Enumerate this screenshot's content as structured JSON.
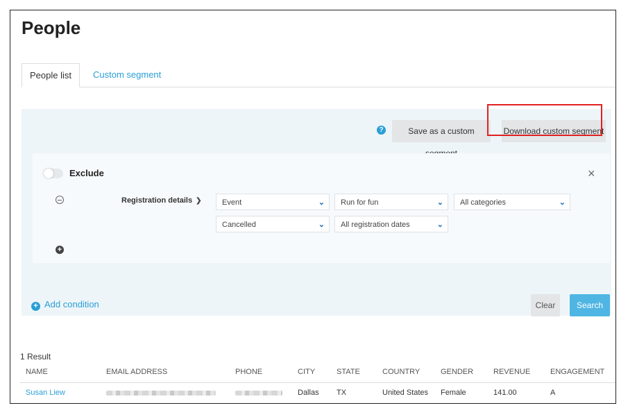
{
  "page": {
    "title": "People"
  },
  "tabs": [
    {
      "label": "People list",
      "active": true
    },
    {
      "label": "Custom segment",
      "active": false
    }
  ],
  "toolbar": {
    "help_icon": "question-circle-icon",
    "save_label": "Save as a custom segment",
    "download_label": "Download custom segment"
  },
  "condition": {
    "exclude_label": "Exclude",
    "exclude_on": false,
    "field_label": "Registration details",
    "selects_row1": [
      "Event",
      "Run for fun",
      "All categories"
    ],
    "selects_row2": [
      "Cancelled",
      "All registration dates"
    ]
  },
  "actions": {
    "add_condition_label": "Add condition",
    "clear_label": "Clear",
    "search_label": "Search"
  },
  "results": {
    "count_label": "1 Result",
    "columns": [
      "NAME",
      "EMAIL ADDRESS",
      "PHONE",
      "CITY",
      "STATE",
      "COUNTRY",
      "GENDER",
      "REVENUE",
      "ENGAGEMENT"
    ],
    "rows": [
      {
        "name": "Susan Liew",
        "city": "Dallas",
        "state": "TX",
        "country": "United States",
        "gender": "Female",
        "revenue": "141.00",
        "engagement": "A"
      }
    ]
  },
  "colors": {
    "accent": "#2a9fd6",
    "highlight": "#e02020",
    "panel": "#eef5f8"
  }
}
